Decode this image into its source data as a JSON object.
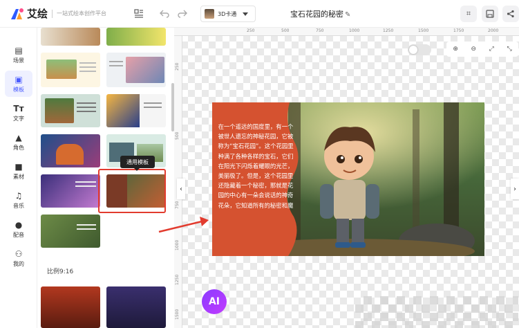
{
  "app": {
    "logo_name": "艾绘",
    "slogan": "一站式绘本创作平台",
    "doc_title": "宝石花园的秘密",
    "style_selector": {
      "label": "3D卡通"
    }
  },
  "header": {
    "icons": [
      "layout-icon",
      "undo-icon",
      "redo-icon",
      "edit-icon",
      "screenshot-icon",
      "save-icon",
      "share-icon"
    ]
  },
  "sidebar": {
    "items": [
      {
        "label": "场景",
        "icon": "scene-icon",
        "active": false
      },
      {
        "label": "模板",
        "icon": "template-icon",
        "active": true
      },
      {
        "label": "文字",
        "icon": "text-icon",
        "active": false
      },
      {
        "label": "角色",
        "icon": "character-icon",
        "active": false
      },
      {
        "label": "素材",
        "icon": "material-icon",
        "active": false
      },
      {
        "label": "音乐",
        "icon": "music-icon",
        "active": false
      },
      {
        "label": "配音",
        "icon": "voice-icon",
        "active": false
      },
      {
        "label": "我的",
        "icon": "my-icon",
        "active": false
      }
    ]
  },
  "template_panel": {
    "tooltip": "通用模板",
    "ratio_label": "比例9:16"
  },
  "canvas": {
    "ruler_h": [
      "250",
      "500",
      "750",
      "1000",
      "1250",
      "1500",
      "1750",
      "2000"
    ],
    "ruler_v": [
      "250",
      "500",
      "750",
      "1000",
      "1250",
      "1500"
    ],
    "zoom_controls": [
      "zoom-in-icon",
      "zoom-out-icon",
      "fit-screen-icon",
      "actual-size-icon"
    ],
    "story_text": "在一个遥远的国度里，有一个被世人遗忘的神秘花园，它被称为“宝石花园”。这个花园里种满了各种各样的宝石，它们在阳光下闪烁着耀眼的光芒，美丽极了。但是，这个花园里还隐藏着一个秘密，那就是花园的中心有一朵会说话的神奇花朵，它知道所有的秘密和魔",
    "ai_button": "AI"
  },
  "colors": {
    "accent": "#4a5cff",
    "highlight": "#e23b2e",
    "story_panel": "#d55230"
  }
}
